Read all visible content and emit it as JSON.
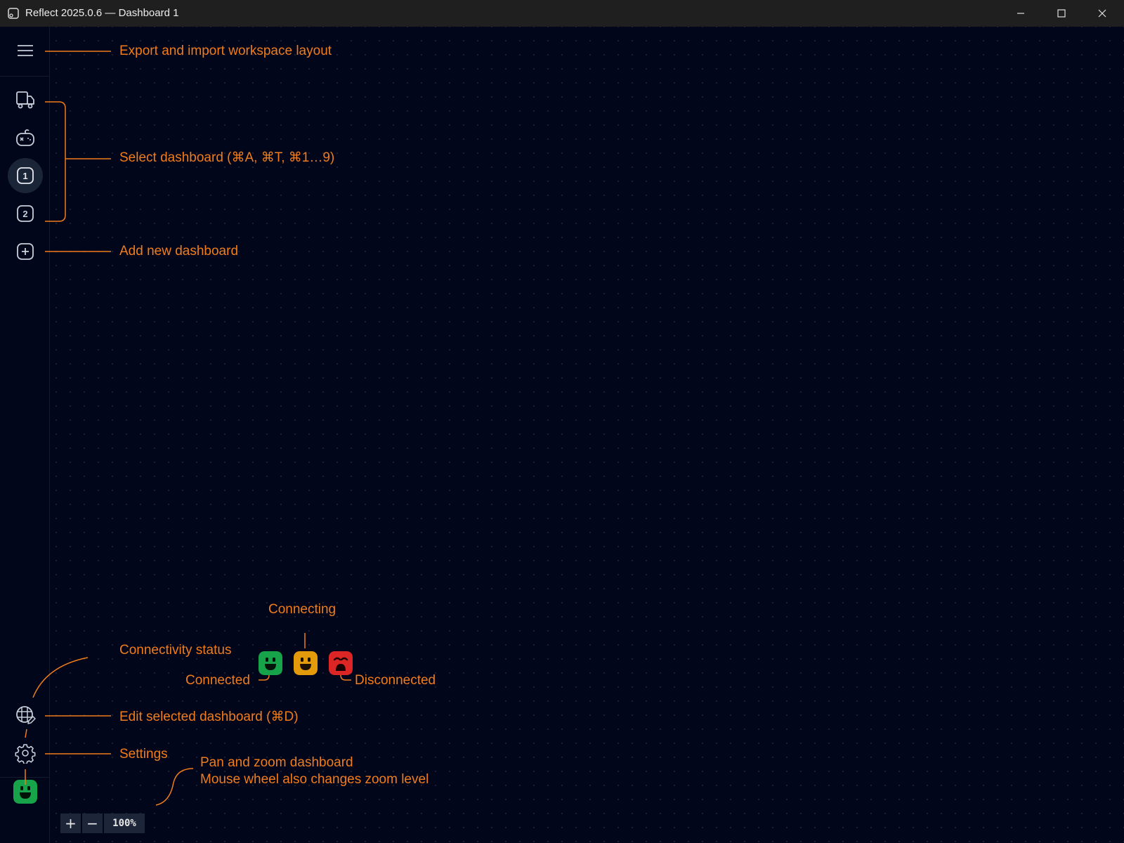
{
  "window": {
    "title": "Reflect 2025.0.6 — Dashboard 1",
    "minimize_icon": "minimize-icon",
    "maximize_icon": "maximize-icon",
    "close_icon": "close-icon"
  },
  "sidebar": {
    "menu_icon": "hamburger-menu-icon",
    "dashboards": [
      {
        "icon": "truck-icon",
        "label": ""
      },
      {
        "icon": "game-controller-icon",
        "label": ""
      },
      {
        "icon": "numbered-badge-icon",
        "label": "1",
        "active": true
      },
      {
        "icon": "numbered-badge-icon",
        "label": "2",
        "active": false
      }
    ],
    "add_icon": "plus-square-icon",
    "edit_icon": "grid-edit-icon",
    "settings_icon": "gear-icon",
    "status_icon": "connected-face-icon"
  },
  "annotations": {
    "export_import": "Export and import workspace layout",
    "select_dashboard": "Select dashboard (⌘A, ⌘T, ⌘1…9)",
    "add_dashboard": "Add new dashboard",
    "connecting": "Connecting",
    "connectivity_status": "Connectivity status",
    "connected": "Connected",
    "disconnected": "Disconnected",
    "edit_dashboard": "Edit selected dashboard (⌘D)",
    "settings": "Settings",
    "pan_zoom_line1": "Pan and zoom dashboard",
    "pan_zoom_line2": "Mouse wheel also changes zoom level"
  },
  "zoom": {
    "zoom_in": "+",
    "zoom_out": "−",
    "level": "100%"
  },
  "colors": {
    "accent": "#f07c1c",
    "connected": "#16a34a",
    "connecting": "#e39b0b",
    "disconnected": "#dc2626",
    "background": "#02061a"
  }
}
